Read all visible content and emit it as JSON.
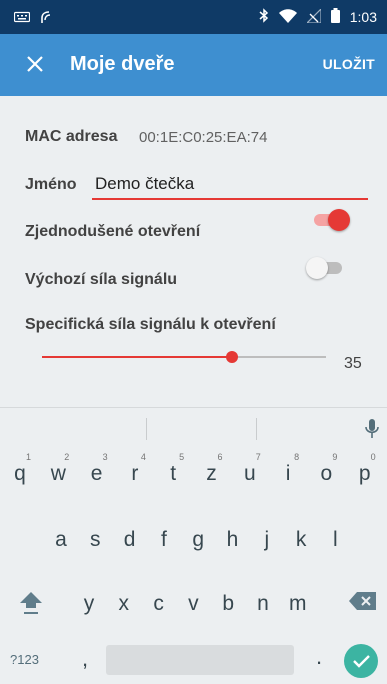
{
  "status_bar": {
    "time": "1:03",
    "icons": [
      "keyboard-icon",
      "signal-tap-icon",
      "bluetooth-icon",
      "wifi-icon",
      "no-signal-icon",
      "battery-icon"
    ]
  },
  "app_bar": {
    "title": "Moje dveře",
    "save_label": "ULOŽIT",
    "close_icon": "close-icon"
  },
  "form": {
    "mac_label": "MAC adresa",
    "mac_value": "00:1E:C0:25:EA:74",
    "name_label": "Jméno",
    "name_value": "Demo čtečka",
    "simplified_open_label": "Zjednodušené otevření",
    "simplified_open_enabled": true,
    "default_signal_label": "Výchozí síla signálu",
    "default_signal_enabled": false,
    "specific_signal_label": "Specifická síla signálu k otevření",
    "specific_signal_value": "35",
    "specific_signal_fraction": 0.67
  },
  "keyboard": {
    "row1": [
      {
        "k": "q",
        "h": "1"
      },
      {
        "k": "w",
        "h": "2"
      },
      {
        "k": "e",
        "h": "3"
      },
      {
        "k": "r",
        "h": "4"
      },
      {
        "k": "t",
        "h": "5"
      },
      {
        "k": "z",
        "h": "6"
      },
      {
        "k": "u",
        "h": "7"
      },
      {
        "k": "i",
        "h": "8"
      },
      {
        "k": "o",
        "h": "9"
      },
      {
        "k": "p",
        "h": "0"
      }
    ],
    "row2": [
      "a",
      "s",
      "d",
      "f",
      "g",
      "h",
      "j",
      "k",
      "l"
    ],
    "row3": [
      "y",
      "x",
      "c",
      "v",
      "b",
      "n",
      "m"
    ],
    "symbols_label": "?123",
    "comma": ",",
    "period": "."
  },
  "colors": {
    "status_bar": "#0f3a66",
    "app_bar": "#3e8fd0",
    "accent": "#e53935",
    "enter_key": "#3cb4a2"
  }
}
